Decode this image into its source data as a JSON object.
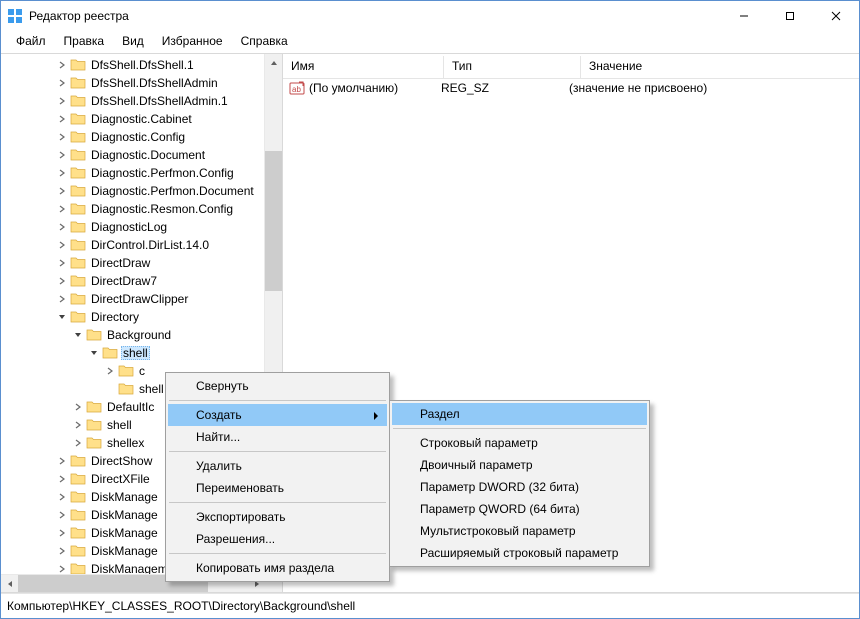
{
  "titlebar": {
    "title": "Редактор реестра"
  },
  "menu": {
    "file": "Файл",
    "edit": "Правка",
    "view": "Вид",
    "favorites": "Избранное",
    "help": "Справка"
  },
  "columns": {
    "name": "Имя",
    "type": "Тип",
    "value": "Значение"
  },
  "colwidths": {
    "name": 144,
    "type": 120,
    "value": 260
  },
  "listrow": {
    "name": "(По умолчанию)",
    "type": "REG_SZ",
    "value": "(значение не присвоено)"
  },
  "status": "Компьютер\\HKEY_CLASSES_ROOT\\Directory\\Background\\shell",
  "tree": [
    {
      "indent": 3,
      "tw": "closed",
      "label": "DfsShell.DfsShell.1"
    },
    {
      "indent": 3,
      "tw": "closed",
      "label": "DfsShell.DfsShellAdmin"
    },
    {
      "indent": 3,
      "tw": "closed",
      "label": "DfsShell.DfsShellAdmin.1"
    },
    {
      "indent": 3,
      "tw": "closed",
      "label": "Diagnostic.Cabinet"
    },
    {
      "indent": 3,
      "tw": "closed",
      "label": "Diagnostic.Config"
    },
    {
      "indent": 3,
      "tw": "closed",
      "label": "Diagnostic.Document"
    },
    {
      "indent": 3,
      "tw": "closed",
      "label": "Diagnostic.Perfmon.Config"
    },
    {
      "indent": 3,
      "tw": "closed",
      "label": "Diagnostic.Perfmon.Document"
    },
    {
      "indent": 3,
      "tw": "closed",
      "label": "Diagnostic.Resmon.Config"
    },
    {
      "indent": 3,
      "tw": "closed",
      "label": "DiagnosticLog"
    },
    {
      "indent": 3,
      "tw": "closed",
      "label": "DirControl.DirList.14.0"
    },
    {
      "indent": 3,
      "tw": "closed",
      "label": "DirectDraw"
    },
    {
      "indent": 3,
      "tw": "closed",
      "label": "DirectDraw7"
    },
    {
      "indent": 3,
      "tw": "closed",
      "label": "DirectDrawClipper"
    },
    {
      "indent": 3,
      "tw": "open",
      "label": "Directory"
    },
    {
      "indent": 4,
      "tw": "open",
      "label": "Background"
    },
    {
      "indent": 5,
      "tw": "open",
      "label": "shell",
      "selected": true
    },
    {
      "indent": 6,
      "tw": "closed",
      "label": "c"
    },
    {
      "indent": 6,
      "tw": "none",
      "label": "shell"
    },
    {
      "indent": 4,
      "tw": "closed",
      "label": "DefaultIc"
    },
    {
      "indent": 4,
      "tw": "closed",
      "label": "shell"
    },
    {
      "indent": 4,
      "tw": "closed",
      "label": "shellex"
    },
    {
      "indent": 3,
      "tw": "closed",
      "label": "DirectShow"
    },
    {
      "indent": 3,
      "tw": "closed",
      "label": "DirectXFile"
    },
    {
      "indent": 3,
      "tw": "closed",
      "label": "DiskManage"
    },
    {
      "indent": 3,
      "tw": "closed",
      "label": "DiskManage"
    },
    {
      "indent": 3,
      "tw": "closed",
      "label": "DiskManage"
    },
    {
      "indent": 3,
      "tw": "closed",
      "label": "DiskManage"
    },
    {
      "indent": 3,
      "tw": "closed",
      "label": "DiskManagement.SnapInAbout"
    }
  ],
  "ctx1": {
    "collapse": "Свернуть",
    "new": "Создать",
    "find": "Найти...",
    "delete": "Удалить",
    "rename": "Переименовать",
    "export": "Экспортировать",
    "permissions": "Разрешения...",
    "copykeyname": "Копировать имя раздела"
  },
  "ctx2": {
    "key": "Раздел",
    "string": "Строковый параметр",
    "binary": "Двоичный параметр",
    "dword": "Параметр DWORD (32 бита)",
    "qword": "Параметр QWORD (64 бита)",
    "multistring": "Мультистроковый параметр",
    "expandstring": "Расширяемый строковый параметр"
  }
}
